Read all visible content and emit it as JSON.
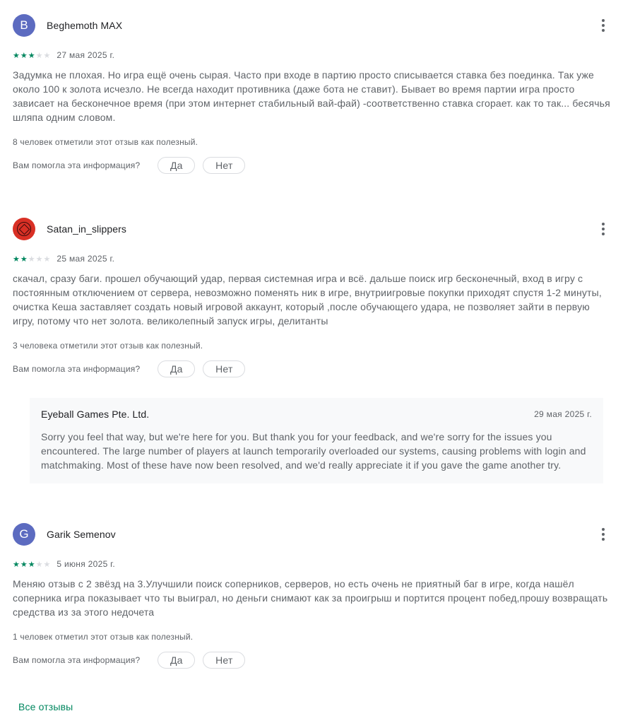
{
  "reviews": [
    {
      "avatar_letter": "B",
      "avatar_color": "#5c6bc0",
      "author": "Beghemoth MAX",
      "rating": 3,
      "date": "27 мая 2025 г.",
      "text": "Задумка не плохая. Но игра ещё очень сырая. Часто при входе в партию просто списывается ставка без поединка. Так уже около 100 к золота исчезло. Не всегда находит противника (даже бота не ставит). Бывает во время партии игра просто зависает на бесконечное время (при этом интернет стабильный вай-фай) -соответственно ставка сгорает. как то так... бесячья шляпа одним словом.",
      "helpful": "8 человек отметили этот отзыв как полезный.",
      "question": "Вам помогла эта информация?",
      "yes": "Да",
      "no": "Нет"
    },
    {
      "avatar_letter": "",
      "avatar_color": "#d93025",
      "author": "Satan_in_slippers",
      "rating": 2,
      "date": "25 мая 2025 г.",
      "text": "скачал, сразу баги. прошел обучающий удар, первая системная игра и всё. дальше поиск игр бесконечный, вход в игру с постоянным отключением от сервера, невозможно поменять ник в игре, внутриигровые покупки приходят спустя 1-2 минуты, очистка Кеша заставляет создать новый игровой аккаунт, который ,после обучающего удара, не позволяет зайти в первую игру, потому что нет золота. великолепный запуск игры, делитанты",
      "helpful": "3 человека отметили этот отзыв как полезный.",
      "question": "Вам помогла эта информация?",
      "yes": "Да",
      "no": "Нет"
    },
    {
      "avatar_letter": "G",
      "avatar_color": "#5c6bc0",
      "author": "Garik Semenov",
      "rating": 3,
      "date": "5 июня 2025 г.",
      "text": "Меняю отзыв с 2 звёзд на 3.Улучшили поиск соперников, серверов, но есть очень не приятный баг в игре, когда нашёл соперника игра показывает что ты выиграл, но деньги снимают как за проигрыш и портится процент побед,прошу возвращать средства из за этого недочета",
      "helpful": "1 человек отметил этот отзыв как полезный.",
      "question": "Вам помогла эта информация?",
      "yes": "Да",
      "no": "Нет"
    }
  ],
  "developer_reply": {
    "developer": "Eyeball Games Pte. Ltd.",
    "date": "29 мая 2025 г.",
    "text": "Sorry you feel that way, but we're here for you. But thank you for your feedback, and we're sorry for the issues you encountered. The large number of players at launch temporarily overloaded our systems, causing problems with login and matchmaking. Most of these have now been resolved, and we'd really appreciate it if you gave the game another try."
  },
  "all_reviews_link": "Все отзывы",
  "colors": {
    "accent_green": "#01875f",
    "star_off": "#dadce0",
    "reply_bg": "#f8f9fa"
  }
}
